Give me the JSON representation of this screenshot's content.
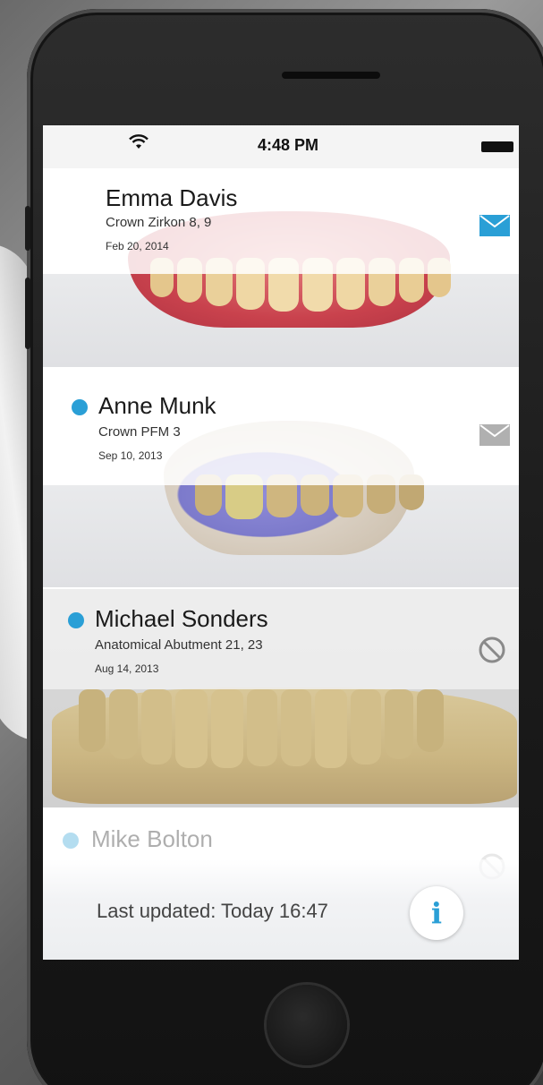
{
  "status_bar": {
    "time": "4:48 PM",
    "wifi_icon": "wifi-icon",
    "battery_icon": "battery-icon"
  },
  "cases": [
    {
      "patient": "Emma Davis",
      "work": "Crown Zirkon 8, 9",
      "date": "Feb 20, 2014",
      "unread": false,
      "status_icon": "mail-icon",
      "status_color": "#2a9fd6"
    },
    {
      "patient": "Anne Munk",
      "work": "Crown PFM 3",
      "date": "Sep 10, 2013",
      "unread": true,
      "status_icon": "mail-icon",
      "status_color": "#a8a8a8"
    },
    {
      "patient": "Michael Sonders",
      "work": "Anatomical Abutment 21, 23",
      "date": "Aug 14, 2013",
      "unread": true,
      "status_icon": "blocked-icon",
      "status_color": "#8a8a8a"
    },
    {
      "patient": "Mike Bolton",
      "unread": true,
      "status_icon": "blocked-icon",
      "status_color": "#c0c0c0"
    }
  ],
  "footer": {
    "last_updated": "Last updated: Today 16:47",
    "info_icon": "info-icon",
    "info_glyph": "i"
  },
  "colors": {
    "accent": "#2a9fd6"
  }
}
